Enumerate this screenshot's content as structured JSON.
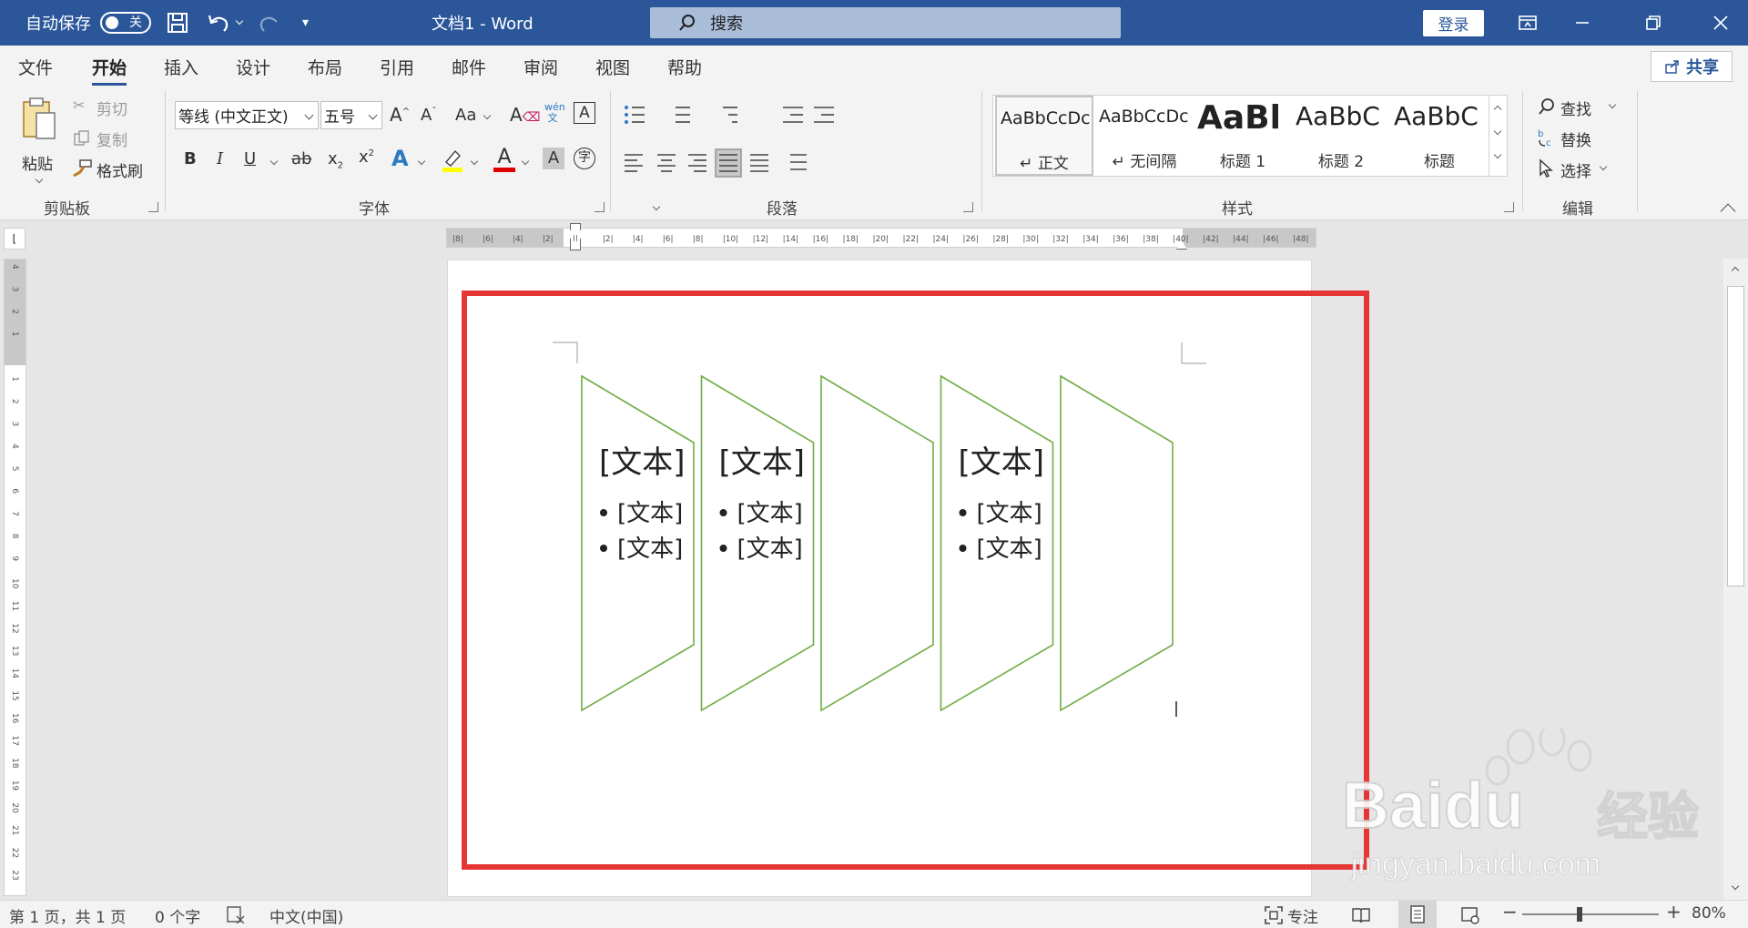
{
  "titlebar": {
    "autosave_label": "自动保存",
    "autosave_state": "关",
    "doc_title": "文档1  -  Word",
    "search_placeholder": "搜索",
    "login_label": "登录"
  },
  "menu": {
    "tabs": [
      "文件",
      "开始",
      "插入",
      "设计",
      "布局",
      "引用",
      "邮件",
      "审阅",
      "视图",
      "帮助"
    ],
    "active_index": 1,
    "share_label": "共享"
  },
  "ribbon": {
    "clipboard": {
      "label": "剪贴板",
      "paste": "粘贴",
      "cut": "剪切",
      "copy": "复制",
      "format_painter": "格式刷"
    },
    "font": {
      "label": "字体",
      "font_name": "等线 (中文正文)",
      "font_size": "五号",
      "aa_label": "Aa"
    },
    "paragraph": {
      "label": "段落"
    },
    "styles": {
      "label": "样式",
      "items": [
        {
          "sample": "AaBbCcDc",
          "name": "↵ 正文"
        },
        {
          "sample": "AaBbCcDc",
          "name": "↵ 无间隔"
        },
        {
          "sample": "AaBl",
          "name": "标题 1"
        },
        {
          "sample": "AaBbC",
          "name": "标题 2"
        },
        {
          "sample": "AaBbC",
          "name": "标题"
        }
      ]
    },
    "editing": {
      "label": "编辑",
      "find": "查找",
      "replace": "替换",
      "select": "选择"
    }
  },
  "ruler": {
    "h_labels": [
      "8",
      "6",
      "4",
      "2",
      "",
      "2",
      "4",
      "6",
      "8",
      "10",
      "12",
      "14",
      "16",
      "18",
      "20",
      "22",
      "24",
      "26",
      "28",
      "30",
      "32",
      "34",
      "36",
      "38",
      "40",
      "42",
      "44",
      "46",
      "48"
    ],
    "v_labels": [
      "4",
      "3",
      "2",
      "1",
      "",
      "1",
      "2",
      "3",
      "4",
      "5",
      "6",
      "7",
      "8",
      "9",
      "10",
      "11",
      "12",
      "13",
      "14",
      "15",
      "16",
      "17",
      "18",
      "19",
      "20",
      "21",
      "22",
      "23"
    ]
  },
  "smartart": {
    "shape_color": "#70ad47",
    "shapes": [
      {
        "heading": "[文本]",
        "bullets": [
          "[文本]",
          "[文本]"
        ]
      },
      {
        "heading": "[文本]",
        "bullets": [
          "[文本]",
          "[文本]"
        ]
      },
      {
        "heading": "",
        "bullets": []
      },
      {
        "heading": "[文本]",
        "bullets": [
          "[文本]",
          "[文本]"
        ]
      },
      {
        "heading": "",
        "bullets": []
      }
    ]
  },
  "highlight_color": "#e63535",
  "status": {
    "page": "第 1 页，共 1 页",
    "words": "0 个字",
    "language": "中文(中国)",
    "focus": "专注",
    "zoom": "80%"
  },
  "watermark": {
    "brand": "Bai",
    "brand2": "du",
    "cn": "经验",
    "url": "jingyan.baidu.com"
  }
}
